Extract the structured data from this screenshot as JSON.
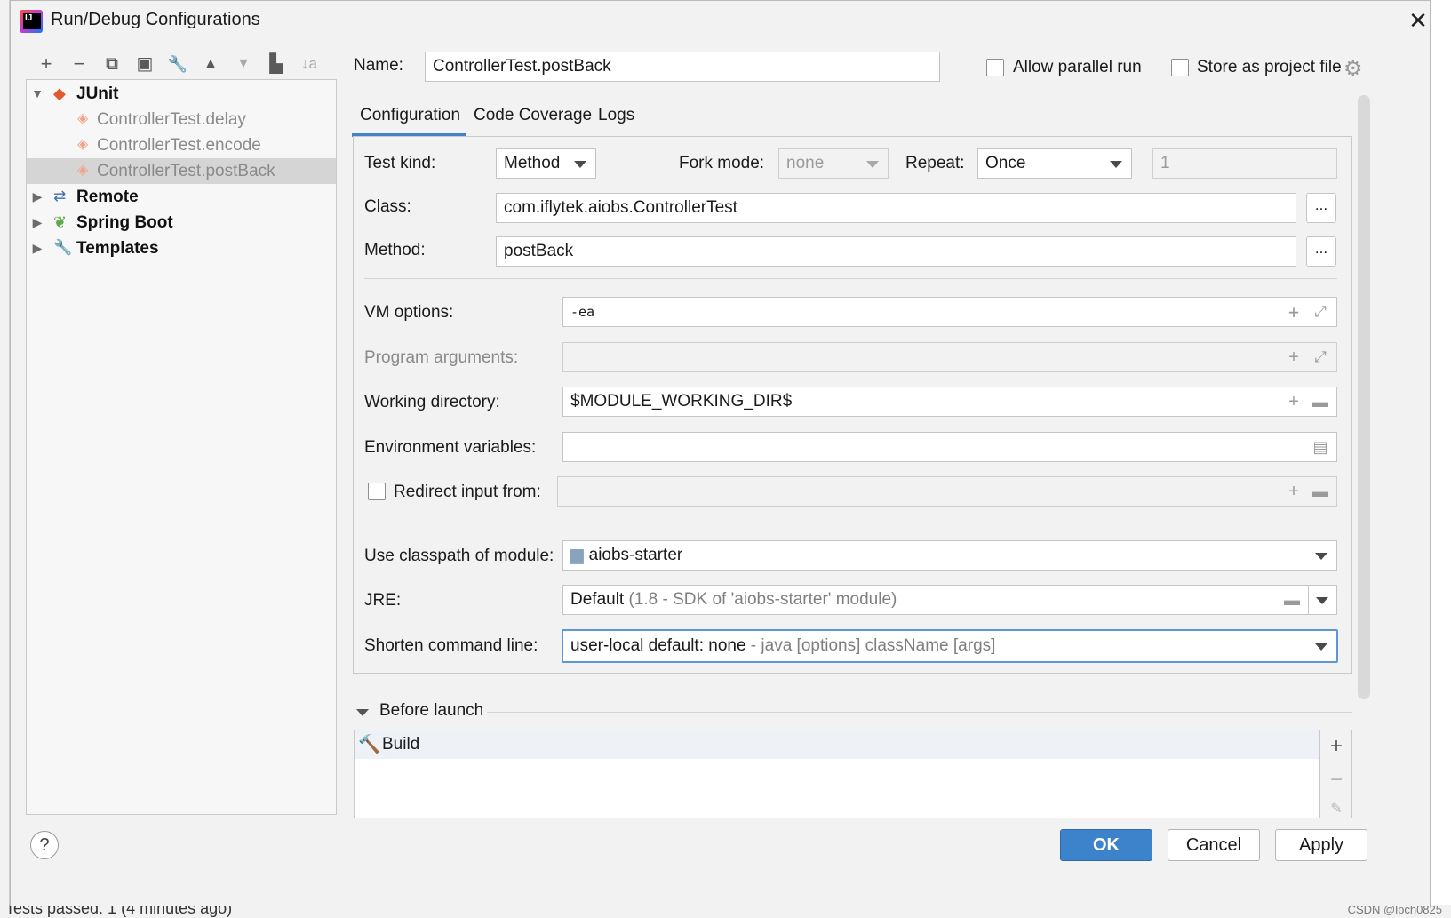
{
  "window": {
    "title": "Run/Debug Configurations"
  },
  "toolbar": {
    "add": "+",
    "remove": "−",
    "copy": "⧉",
    "save": "▣",
    "edit": "🔧",
    "up": "▲",
    "down": "▼",
    "folder": "▙",
    "sort": "↓a"
  },
  "tree": {
    "junit": "JUnit",
    "junit_children": [
      "ControllerTest.delay",
      "ControllerTest.encode",
      "ControllerTest.postBack"
    ],
    "selected": "ControllerTest.postBack",
    "remote": "Remote",
    "spring_boot": "Spring Boot",
    "templates": "Templates"
  },
  "header": {
    "name_label": "Name:",
    "name_value": "ControllerTest.postBack",
    "allow_parallel": "Allow parallel run",
    "store_project": "Store as project file"
  },
  "tabs": [
    "Configuration",
    "Code Coverage",
    "Logs"
  ],
  "config": {
    "test_kind_label": "Test kind:",
    "test_kind_value": "Method",
    "fork_mode_label": "Fork mode:",
    "fork_mode_value": "none",
    "repeat_label": "Repeat:",
    "repeat_value": "Once",
    "repeat_count": "1",
    "class_label": "Class:",
    "class_value": "com.iflytek.aiobs.ControllerTest",
    "method_label": "Method:",
    "method_value": "postBack",
    "dots": "...",
    "vm_label": "VM options:",
    "vm_value": "-ea",
    "prog_args_label": "Program arguments:",
    "workdir_label": "Working directory:",
    "workdir_value": "$MODULE_WORKING_DIR$",
    "env_label": "Environment variables:",
    "redirect_label": "Redirect input from:",
    "classpath_label": "Use classpath of module:",
    "classpath_value": "aiobs-starter",
    "jre_label": "JRE:",
    "jre_value": "Default",
    "jre_suffix": "(1.8 - SDK of 'aiobs-starter' module)",
    "shorten_label": "Shorten command line:",
    "shorten_value": "user-local default: none",
    "shorten_suffix": "- java [options] className [args]"
  },
  "before_launch": {
    "title": "Before launch",
    "items": [
      "Build"
    ]
  },
  "buttons": {
    "ok": "OK",
    "cancel": "Cancel",
    "apply": "Apply",
    "help": "?"
  },
  "background": {
    "status_left": "Tests passed: 1 (4 minutes ago)",
    "watermark": "CSDN @lpch0825"
  }
}
